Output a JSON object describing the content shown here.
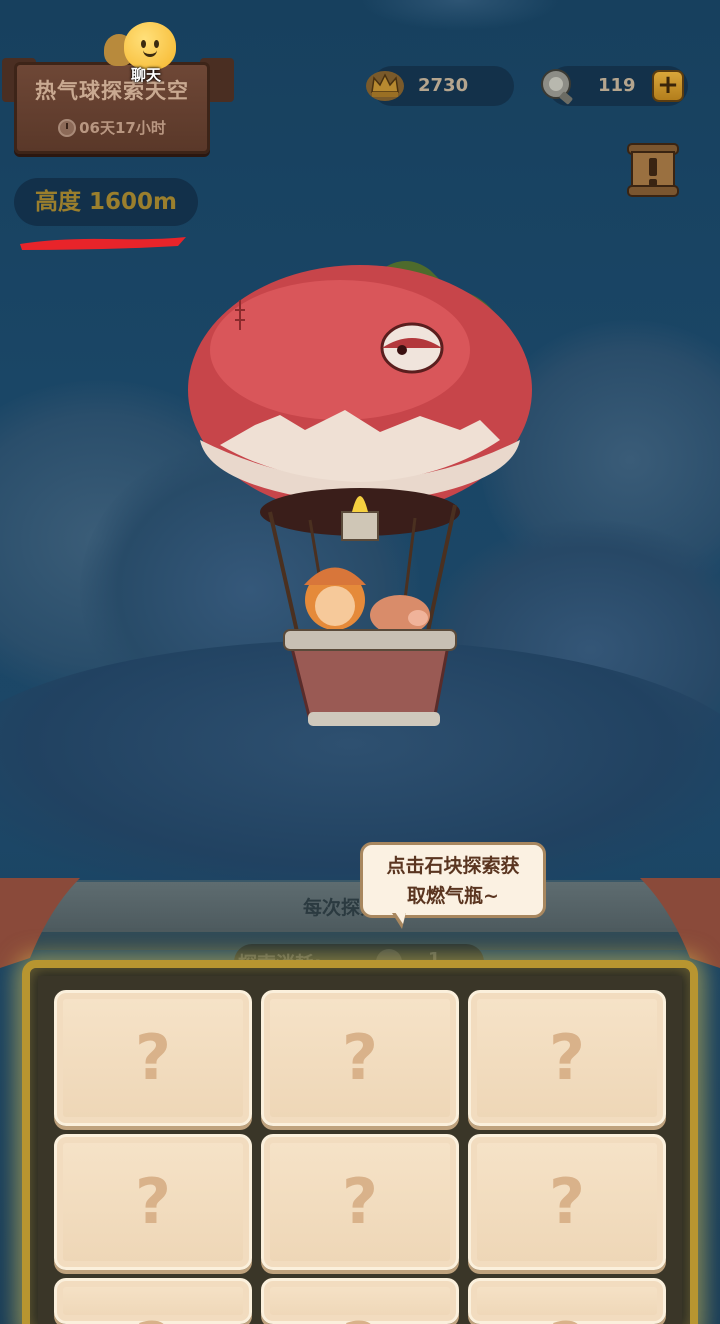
{
  "event": {
    "title": "热气球探索天空",
    "countdown": "06天17小时"
  },
  "chat": {
    "label": "聊天"
  },
  "currencies": {
    "crowns": "2730",
    "gas": "119"
  },
  "altitude": {
    "label": "高度 1600m"
  },
  "panel": {
    "hint": "每次探索可额",
    "cost_label": "探索消耗:",
    "cost_value": "1"
  },
  "tooltip": {
    "line1": "点击石块探索获",
    "line2": "取燃气瓶~"
  },
  "tiles": [
    "?",
    "?",
    "?",
    "?",
    "?",
    "?",
    "?",
    "?",
    "?"
  ],
  "colors": {
    "sky": "#1a4666",
    "board_glow": "#e6c850",
    "tile": "#f6e3c8",
    "question_mark": "#d9b28a",
    "balloon_red": "#d9454a",
    "altitude_text": "#9b7f2d"
  },
  "icons": {
    "chat": "chat-bubble-face-icon",
    "timer": "clock-icon",
    "crowns": "crown-icon",
    "gas": "gas-tank-icon",
    "add": "plus-icon",
    "info": "scroll-exclamation-icon"
  }
}
